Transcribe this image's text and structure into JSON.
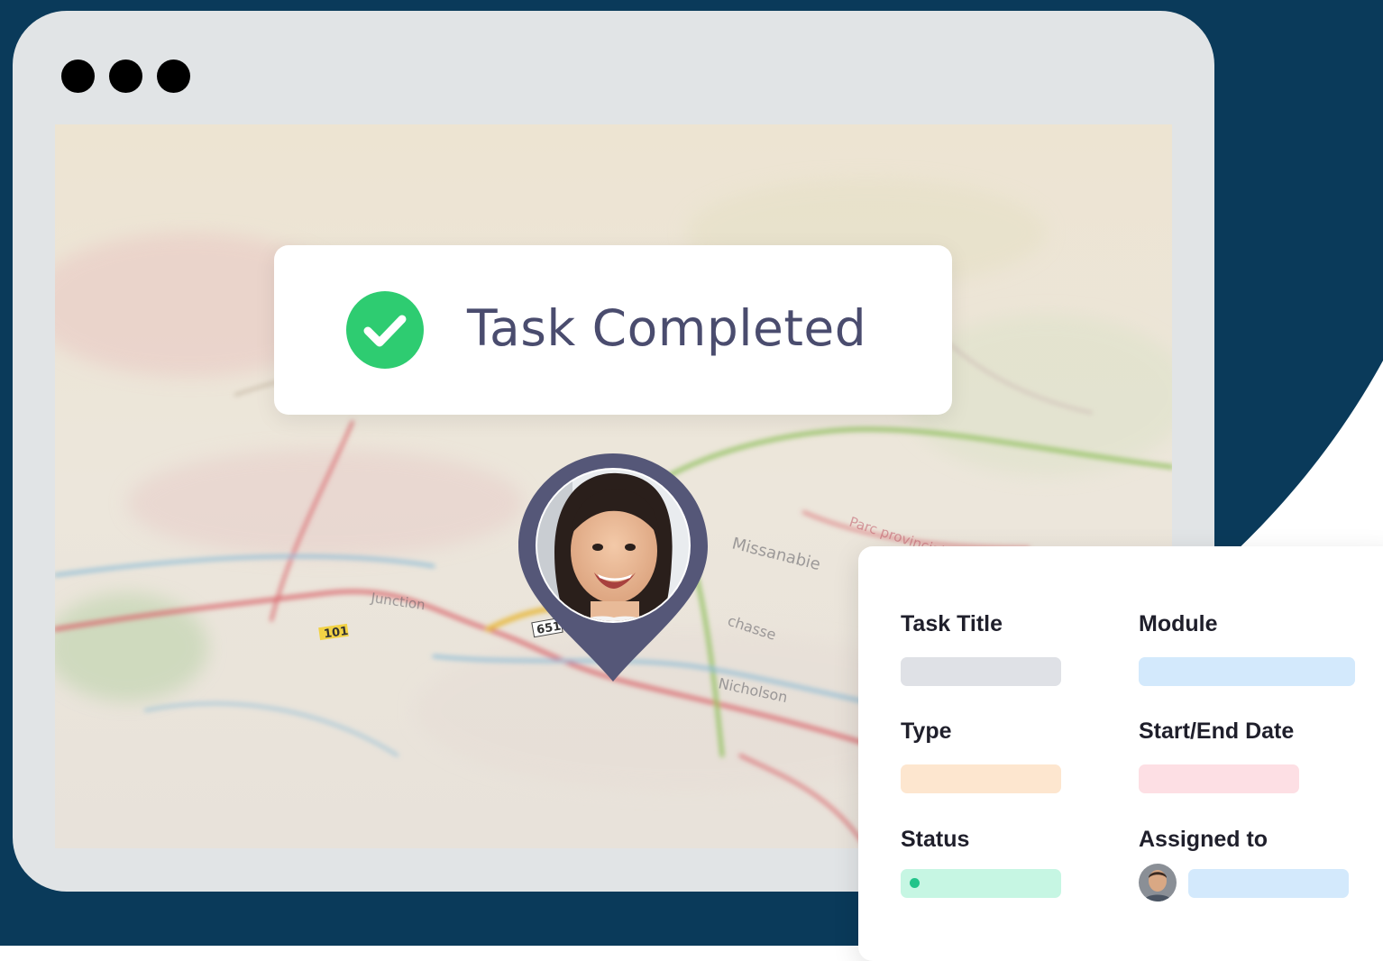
{
  "window": {
    "dots": [
      "close-dot",
      "minimize-dot",
      "maximize-dot"
    ]
  },
  "toast": {
    "icon": "check-circle-icon",
    "message": "Task Completed"
  },
  "map": {
    "labels": [
      "Missanabie",
      "Parc provincial",
      "chasse",
      "Nicholson",
      "Junction",
      "101",
      "651"
    ],
    "pin_icon": "location-pin-icon",
    "pin_avatar": "woman-avatar"
  },
  "task_card": {
    "fields": [
      {
        "label": "Task Title"
      },
      {
        "label": "Module"
      },
      {
        "label": "Type"
      },
      {
        "label": "Start/End Date"
      },
      {
        "label": "Status"
      },
      {
        "label": "Assigned to"
      }
    ],
    "assignee_avatar": "man-avatar"
  },
  "colors": {
    "navy": "#0a3a5a",
    "window": "#e1e4e6",
    "check_green": "#2ecc71",
    "pin": "#555778",
    "toast_text": "#4a4c6e",
    "bar_gray": "#dfe1e6",
    "bar_blue": "#d3e9fc",
    "bar_peach": "#fde6cf",
    "bar_pink": "#fddfe4",
    "bar_mint": "#c6f6e3",
    "status_dot": "#22c48a"
  }
}
